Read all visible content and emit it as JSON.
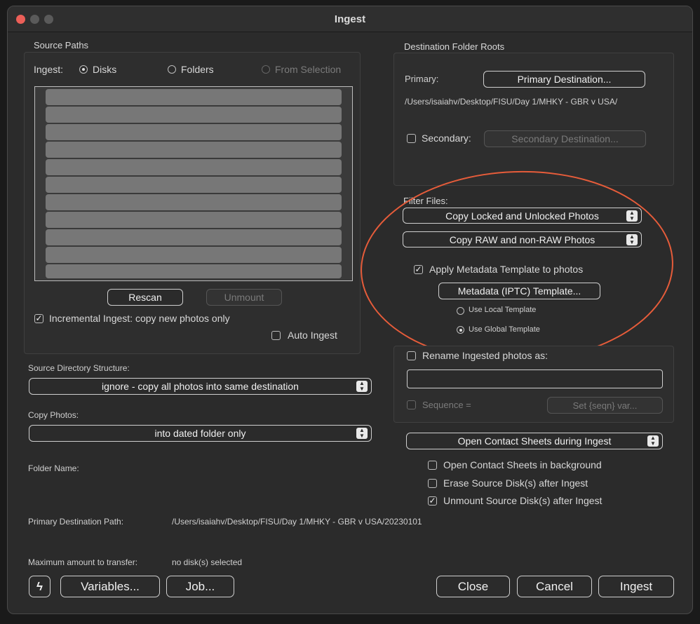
{
  "window": {
    "title": "Ingest",
    "traffic_colors": [
      "#ec5f58",
      "#5a5a5a",
      "#5a5a5a"
    ]
  },
  "source": {
    "group_label": "Source Paths",
    "ingest_label": "Ingest:",
    "options": [
      "Disks",
      "Folders",
      "From Selection"
    ],
    "rescan": "Rescan",
    "unmount": "Unmount",
    "incremental": "Incremental Ingest: copy new photos only",
    "auto_ingest": "Auto Ingest"
  },
  "structure": {
    "label": "Source Directory Structure:",
    "value": "ignore - copy all photos into same destination"
  },
  "copy_photos": {
    "label": "Copy Photos:",
    "value": "into dated folder only"
  },
  "folder_name": {
    "label": "Folder Name:"
  },
  "primary_path": {
    "label": "Primary Destination Path:",
    "value": "/Users/isaiahv/Desktop/FISU/Day 1/MHKY - GBR v USA/20230101"
  },
  "max_transfer": {
    "label": "Maximum amount to transfer:",
    "value": "no disk(s) selected"
  },
  "bottom": {
    "lightning": "ϟ",
    "variables": "Variables...",
    "job": "Job...",
    "close": "Close",
    "cancel": "Cancel",
    "ingest": "Ingest"
  },
  "destination": {
    "group_label": "Destination Folder Roots",
    "primary_label": "Primary:",
    "primary_button": "Primary Destination...",
    "primary_path": "/Users/isaiahv/Desktop/FISU/Day 1/MHKY - GBR v USA/",
    "secondary_label": "Secondary:",
    "secondary_button": "Secondary Destination..."
  },
  "filter": {
    "label": "Filter Files:",
    "locked": "Copy Locked and Unlocked Photos",
    "raw": "Copy RAW and non-RAW Photos",
    "apply_template": "Apply Metadata Template to photos",
    "template_button": "Metadata (IPTC) Template...",
    "use_local": "Use Local Template",
    "use_global": "Use Global Template",
    "highlight_color": "#e65c3a"
  },
  "rename": {
    "label": "Rename Ingested photos as:",
    "sequence": "Sequence =",
    "set_var": "Set {seqn} var..."
  },
  "contact": {
    "select": "Open Contact Sheets during Ingest",
    "background": "Open Contact Sheets in background",
    "erase": "Erase Source Disk(s) after Ingest",
    "unmount": "Unmount Source Disk(s) after Ingest"
  }
}
